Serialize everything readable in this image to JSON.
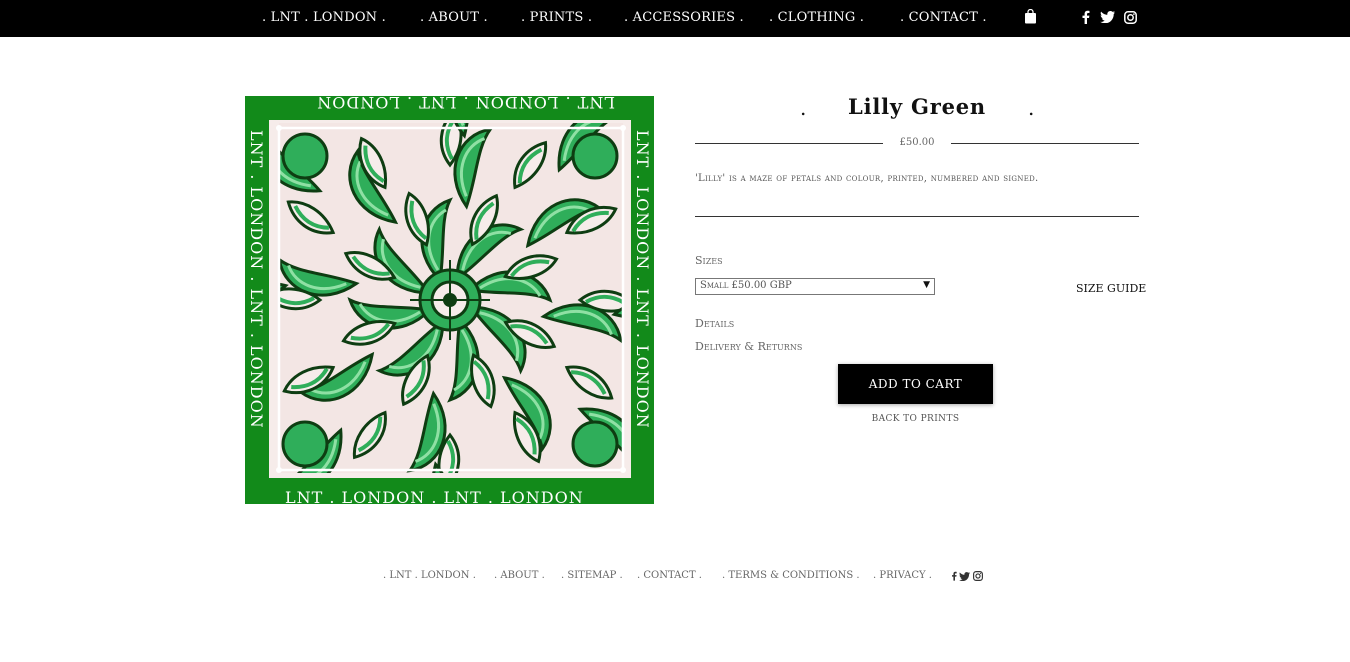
{
  "nav": {
    "items": [
      {
        "label": ". LNT . LONDON ."
      },
      {
        "label": ". ABOUT ."
      },
      {
        "label": ". PRINTS ."
      },
      {
        "label": ". ACCESSORIES ."
      },
      {
        "label": ". CLOTHING ."
      },
      {
        "label": ". CONTACT ."
      }
    ],
    "icons": [
      "shopping-bag-icon",
      "facebook-icon",
      "twitter-icon",
      "instagram-icon"
    ]
  },
  "product": {
    "title": "Lilly Green",
    "title_dot": ".",
    "price": "£50.00",
    "description": "'Lilly' is a maze of petals and colour, printed, numbered and signed.",
    "image_border_text": "LNT . LONDON . LNT . LONDON",
    "image_colors": {
      "border": "#128a1a",
      "dark": "#0e3d12",
      "mid": "#2fae5a",
      "light": "#f6ecea"
    },
    "sizes_label": "Sizes",
    "size_selected": "Small £50.00 GBP",
    "size_guide": "SIZE GUIDE",
    "details_label": "Details",
    "delivery_label": "Delivery & Returns",
    "add_to_cart": "ADD TO CART",
    "back_link": "BACK TO PRINTS"
  },
  "footer": {
    "items": [
      {
        "label": ". LNT . LONDON ."
      },
      {
        "label": ". ABOUT ."
      },
      {
        "label": ". SITEMAP ."
      },
      {
        "label": ". CONTACT ."
      },
      {
        "label": ". TERMS & CONDITIONS ."
      },
      {
        "label": ". PRIVACY ."
      }
    ],
    "icons": [
      "facebook-icon",
      "twitter-icon",
      "instagram-icon"
    ]
  }
}
